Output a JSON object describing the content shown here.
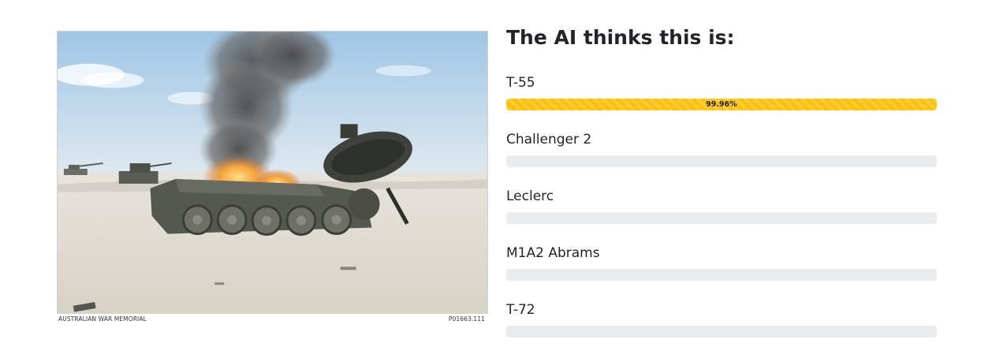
{
  "photo": {
    "alt": "Destroyed burning tank in the desert",
    "caption_left": "AUSTRALIAN WAR MEMORIAL",
    "caption_right": "P01663.111"
  },
  "results": {
    "heading": "The AI thinks this is:",
    "predictions": [
      {
        "label": "T-55",
        "percent": 99.96,
        "percent_text": "99.96%"
      },
      {
        "label": "Challenger 2",
        "percent": 0,
        "percent_text": ""
      },
      {
        "label": "Leclerc",
        "percent": 0,
        "percent_text": ""
      },
      {
        "label": "M1A2 Abrams",
        "percent": 0,
        "percent_text": ""
      },
      {
        "label": "T-72",
        "percent": 0,
        "percent_text": ""
      }
    ]
  },
  "colors": {
    "bar_fill": "#ffc107",
    "bar_track": "#e9ecef"
  }
}
